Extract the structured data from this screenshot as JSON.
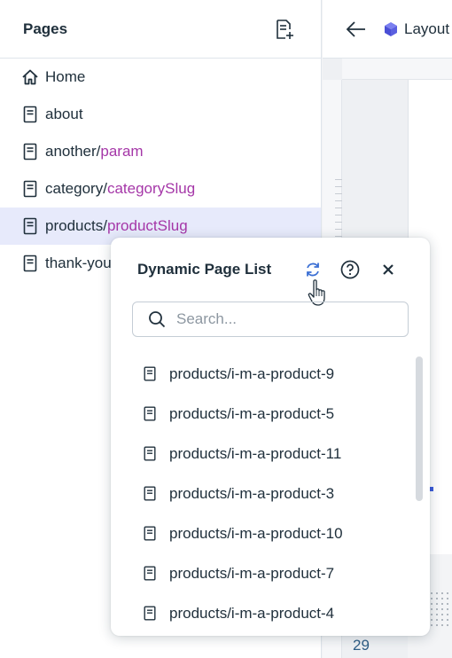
{
  "pages_panel": {
    "title": "Pages",
    "add_page_icon": "add-page-icon",
    "items": [
      {
        "icon": "home-icon",
        "base": "Home",
        "param": ""
      },
      {
        "icon": "page-icon",
        "base": "about",
        "param": ""
      },
      {
        "icon": "page-icon",
        "base": "another/",
        "param": "param"
      },
      {
        "icon": "page-icon",
        "base": "category/",
        "param": "categorySlug"
      },
      {
        "icon": "page-icon",
        "base": "products/",
        "param": "productSlug",
        "selected": true
      },
      {
        "icon": "page-icon",
        "base": "thank-you",
        "param": ""
      }
    ]
  },
  "editor": {
    "back_icon": "arrow-left-icon",
    "layout_icon": "cube-icon",
    "layout_label": "Layout",
    "row_number": "29"
  },
  "popup": {
    "title": "Dynamic Page List",
    "refresh_icon": "refresh-icon",
    "help_icon": "help-icon",
    "close_icon": "close-icon",
    "search_placeholder": "Search...",
    "search_value": "",
    "items": [
      "products/i-m-a-product-9",
      "products/i-m-a-product-5",
      "products/i-m-a-product-11",
      "products/i-m-a-product-3",
      "products/i-m-a-product-10",
      "products/i-m-a-product-7",
      "products/i-m-a-product-4"
    ]
  },
  "colors": {
    "param": "#a537a8",
    "selected_row": "#e7eafb",
    "refresh_accent": "#3b6fd4",
    "layout_cube": "#5a5fe0"
  }
}
